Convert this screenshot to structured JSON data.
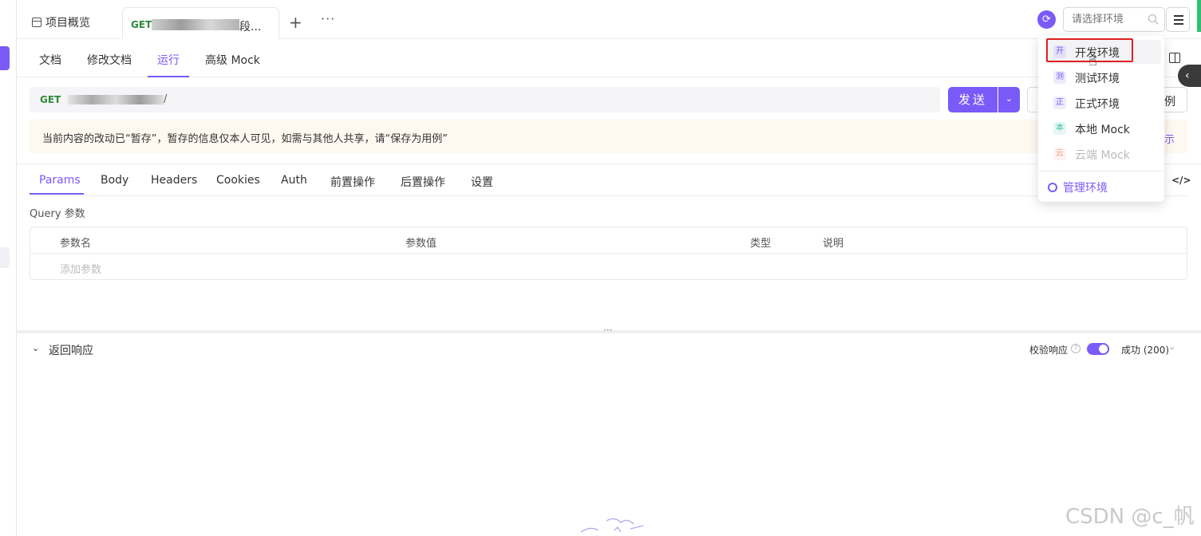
{
  "tabs": {
    "overview": "项目概览",
    "active_method": "GET",
    "active_name": "段..."
  },
  "env": {
    "placeholder": "请选择环境",
    "items": [
      {
        "badge": "开",
        "label": "开发环境",
        "badge_color": "#7a5af8"
      },
      {
        "badge": "测",
        "label": "测试环境",
        "badge_color": "#7a5af8"
      },
      {
        "badge": "正",
        "label": "正式环境",
        "badge_color": "#7a5af8"
      },
      {
        "badge": "本",
        "label": "本地 Mock",
        "badge_color": "#2fbfa0"
      },
      {
        "badge": "云",
        "label": "云端 Mock",
        "badge_color": "#f0a080"
      }
    ],
    "manage": "管理环境"
  },
  "subtabs": [
    "文档",
    "修改文档",
    "运行",
    "高级 Mock"
  ],
  "request": {
    "method": "GET",
    "path_suffix": "/",
    "send": "发送",
    "save_partial": "例"
  },
  "notice": {
    "text": "当前内容的改动已“暂存”，暂存的信息仅本人可见，如需与其他人共享，请“保存为用例”",
    "action": "示"
  },
  "req_tabs": [
    "Params",
    "Body",
    "Headers",
    "Cookies",
    "Auth",
    "前置操作",
    "后置操作",
    "设置"
  ],
  "params": {
    "section": "Query 参数",
    "headers": [
      "参数名",
      "参数值",
      "类型",
      "说明"
    ],
    "add": "添加参数"
  },
  "response": {
    "title": "返回响应",
    "verify": "校验响应",
    "status": "成功 (200)"
  },
  "watermark": "CSDN @c_帆",
  "colors": {
    "accent": "#7a5af8",
    "get": "#2f8a3c"
  }
}
